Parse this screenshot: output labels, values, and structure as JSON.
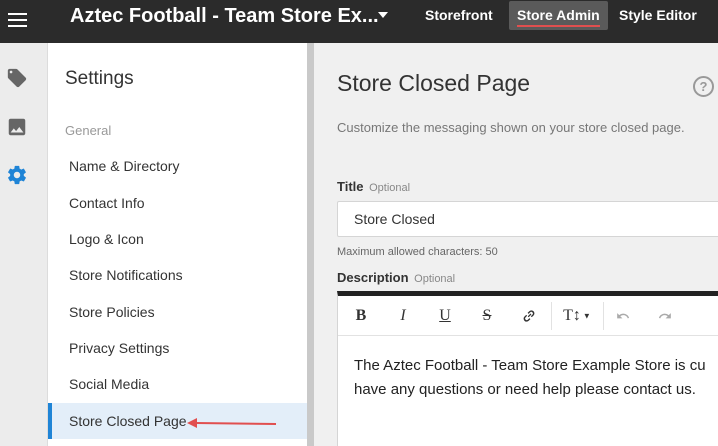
{
  "header": {
    "store_title": "Aztec Football - Team Store Ex...",
    "nav": {
      "storefront": "Storefront",
      "store_admin": "Store Admin",
      "style_editor": "Style Editor"
    }
  },
  "rail": {
    "icons": [
      "tag-icon",
      "image-icon",
      "gear-icon"
    ],
    "active_color": "#1f84d6"
  },
  "sidebar": {
    "title": "Settings",
    "group_label": "General",
    "items": [
      {
        "label": "Name & Directory"
      },
      {
        "label": "Contact Info"
      },
      {
        "label": "Logo & Icon"
      },
      {
        "label": "Store Notifications"
      },
      {
        "label": "Store Policies"
      },
      {
        "label": "Privacy Settings"
      },
      {
        "label": "Social Media"
      },
      {
        "label": "Store Closed Page",
        "active": true
      }
    ]
  },
  "main": {
    "title": "Store Closed Page",
    "help_glyph": "?",
    "subtitle": "Customize the messaging shown on your store closed page.",
    "title_field": {
      "label": "Title",
      "optional": "Optional",
      "value": "Store Closed",
      "hint": "Maximum allowed characters: 50"
    },
    "description_field": {
      "label": "Description",
      "optional": "Optional",
      "toolbar": {
        "bold": "B",
        "italic": "I",
        "underline": "U",
        "strike": "S",
        "text_size": "T↕"
      },
      "body_line1": "The Aztec Football - Team Store Example Store is cu",
      "body_line2": "have any questions or need help please contact us."
    }
  },
  "colors": {
    "topbar": "#2b2b2b",
    "accent": "#1f84d6",
    "annotation": "#e14f4f"
  }
}
